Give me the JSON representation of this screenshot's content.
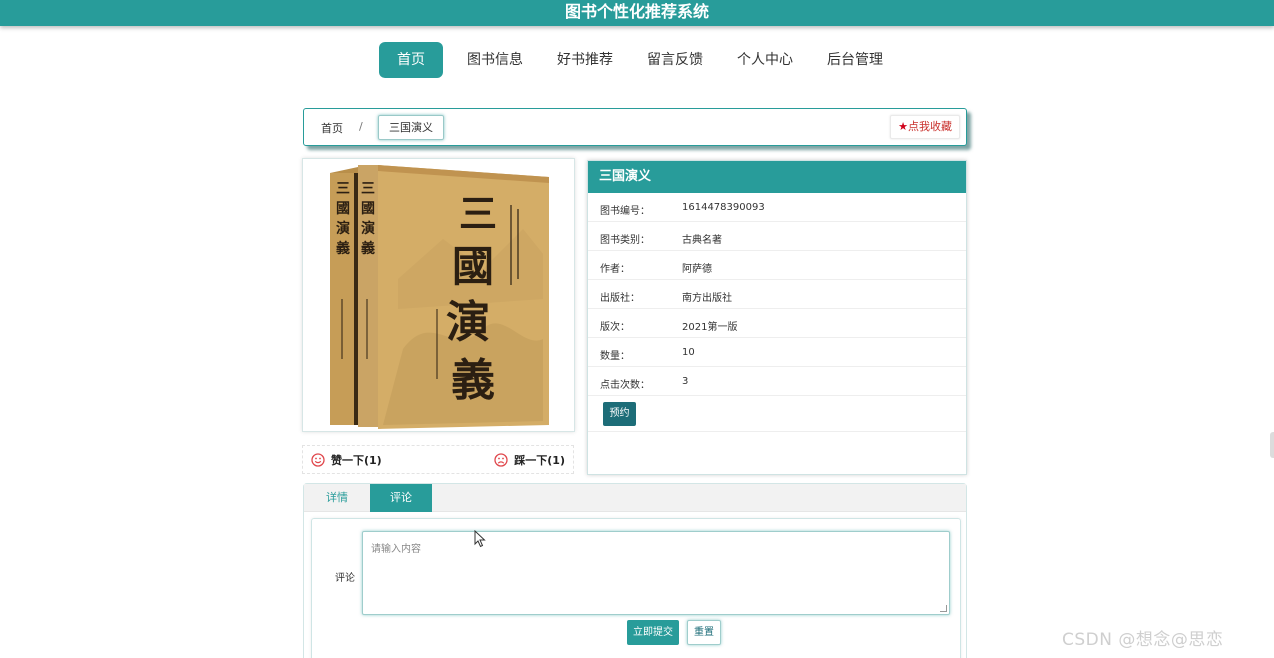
{
  "app": {
    "title": "图书个性化推荐系统"
  },
  "nav": [
    {
      "label": "首页",
      "active": true
    },
    {
      "label": "图书信息"
    },
    {
      "label": "好书推荐"
    },
    {
      "label": "留言反馈"
    },
    {
      "label": "个人中心"
    },
    {
      "label": "后台管理"
    }
  ],
  "breadcrumb": {
    "home": "首页",
    "separator": "/",
    "current": "三国演义"
  },
  "favorite": {
    "label": "点我收藏",
    "icon": "star-icon"
  },
  "book": {
    "title": "三国演义",
    "cover_icon": "book-cover-image",
    "fields": [
      {
        "key": "图书编号：",
        "value": "1614478390093"
      },
      {
        "key": "图书类别：",
        "value": "古典名著"
      },
      {
        "key": "作者：",
        "value": "阿萨德"
      },
      {
        "key": "出版社：",
        "value": "南方出版社"
      },
      {
        "key": "版次：",
        "value": "2021第一版"
      },
      {
        "key": "数量：",
        "value": "10"
      },
      {
        "key": "点击次数：",
        "value": "3"
      }
    ],
    "reserve_label": "预约"
  },
  "votes": {
    "like_label": "赞一下(1)",
    "dislike_label": "踩一下(1)"
  },
  "tabs": [
    {
      "label": "详情",
      "active": false
    },
    {
      "label": "评论",
      "active": true
    }
  ],
  "comment": {
    "label": "评论",
    "placeholder": "请输入内容",
    "submit_label": "立即提交",
    "reset_label": "重置"
  },
  "watermark": "CSDN @想念@思恋",
  "colors": {
    "primary": "#289c9a",
    "dark": "#1d6d78",
    "danger": "#d0021b"
  }
}
